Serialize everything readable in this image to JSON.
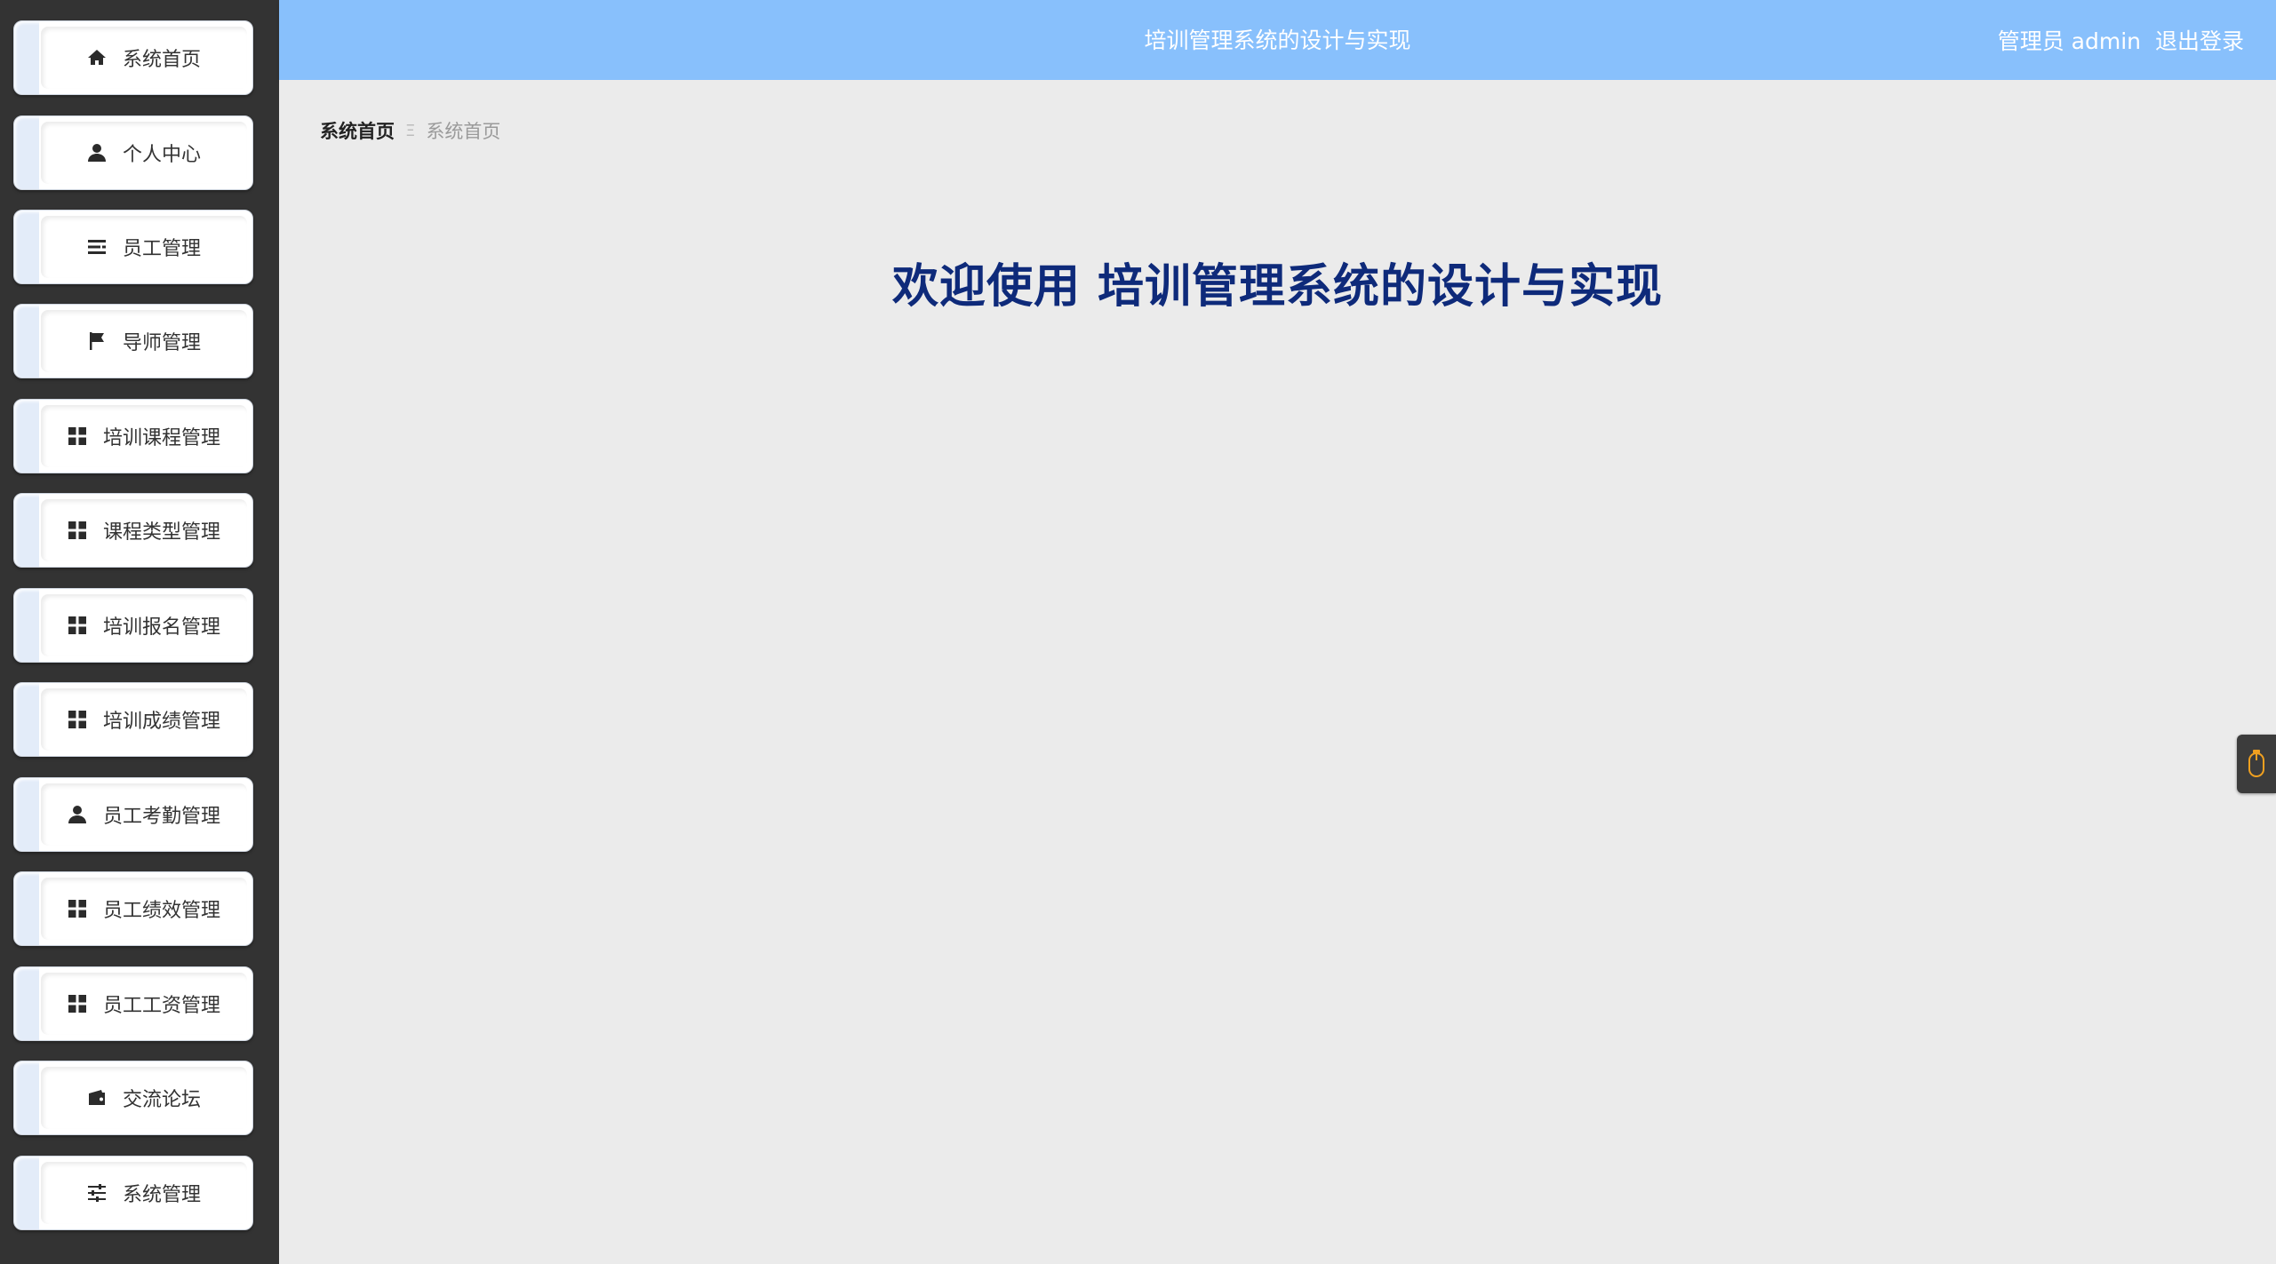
{
  "header": {
    "title": "培训管理系统的设计与实现",
    "user_label": "管理员 admin",
    "logout_label": "退出登录"
  },
  "sidebar": {
    "items": [
      {
        "label": "系统首页",
        "icon": "home-icon"
      },
      {
        "label": "个人中心",
        "icon": "user-icon"
      },
      {
        "label": "员工管理",
        "icon": "list-icon"
      },
      {
        "label": "导师管理",
        "icon": "flag-icon"
      },
      {
        "label": "培训课程管理",
        "icon": "grid-icon"
      },
      {
        "label": "课程类型管理",
        "icon": "grid-icon"
      },
      {
        "label": "培训报名管理",
        "icon": "grid-icon"
      },
      {
        "label": "培训成绩管理",
        "icon": "grid-icon"
      },
      {
        "label": "员工考勤管理",
        "icon": "user-icon"
      },
      {
        "label": "员工绩效管理",
        "icon": "grid-icon"
      },
      {
        "label": "员工工资管理",
        "icon": "grid-icon"
      },
      {
        "label": "交流论坛",
        "icon": "wallet-icon"
      },
      {
        "label": "系统管理",
        "icon": "sliders-icon"
      }
    ]
  },
  "breadcrumb": {
    "current": "系统首页",
    "separator": "Ξ",
    "page": "系统首页"
  },
  "main": {
    "welcome": "欢迎使用 培训管理系统的设计与实现"
  },
  "colors": {
    "header_bg": "#88c0fc",
    "sidebar_bg": "#333333",
    "welcome_text": "#0e2a7a",
    "widget_accent": "#f0a020"
  }
}
